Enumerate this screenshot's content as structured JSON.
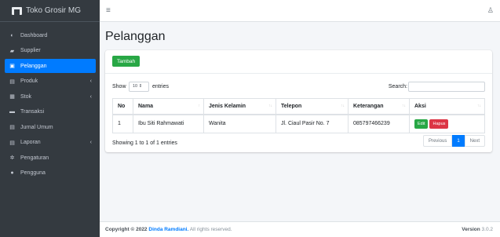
{
  "brand": {
    "name": "Toko Grosir MG"
  },
  "sidebar": {
    "items": [
      {
        "label": "Dashboard",
        "icon": "dashboard-icon",
        "glyph": "◐",
        "active": false,
        "has_children": false
      },
      {
        "label": "Supplier",
        "icon": "truck-icon",
        "glyph": "▰",
        "active": false,
        "has_children": false
      },
      {
        "label": "Pelanggan",
        "icon": "user-icon",
        "glyph": "▣",
        "active": true,
        "has_children": false
      },
      {
        "label": "Produk",
        "icon": "box-icon",
        "glyph": "▤",
        "active": false,
        "has_children": true
      },
      {
        "label": "Stok",
        "icon": "boxes-icon",
        "glyph": "▦",
        "active": false,
        "has_children": true
      },
      {
        "label": "Transaksi",
        "icon": "cash-icon",
        "glyph": "▬",
        "active": false,
        "has_children": false
      },
      {
        "label": "Jurnal Umum",
        "icon": "book-icon",
        "glyph": "▤",
        "active": false,
        "has_children": false
      },
      {
        "label": "Laporan",
        "icon": "file-icon",
        "glyph": "▤",
        "active": false,
        "has_children": true
      },
      {
        "label": "Pengaturan",
        "icon": "gear-icon",
        "glyph": "✲",
        "active": false,
        "has_children": false
      },
      {
        "label": "Pengguna",
        "icon": "users-icon",
        "glyph": "●",
        "active": false,
        "has_children": false
      }
    ]
  },
  "topbar": {
    "menu_icon": "hamburger-icon",
    "user_icon": "user-icon"
  },
  "page": {
    "title": "Pelanggan"
  },
  "card": {
    "add_button": "Tambah",
    "show_label": "Show",
    "page_length": "10",
    "entries_label": "entries",
    "search_label": "Search:",
    "search_value": ""
  },
  "table": {
    "headers": [
      "No",
      "Nama",
      "Jenis Kelamin",
      "Telepon",
      "Keterangan",
      "Aksi"
    ],
    "rows": [
      {
        "no": "1",
        "nama": "Ibu Siti Rahmawati",
        "jenis_kelamin": "Wanita",
        "telepon": "Jl. Ciaul Pasir No. 7",
        "keterangan": "085797466239",
        "edit_label": "Edit",
        "hapus_label": "Hapus"
      }
    ]
  },
  "info": {
    "showing": "Showing 1 to 1 of 1 entries"
  },
  "pagination": {
    "previous": "Previous",
    "current": "1",
    "next": "Next"
  },
  "footer": {
    "copyright_prefix": "Copyright © 2022",
    "author": "Dinda Ramdiani.",
    "rights": "All rights reserved.",
    "version_label": "Version",
    "version_value": "3.0.2"
  },
  "colors": {
    "sidebar": "#343a40",
    "active": "#007bff",
    "success": "#28a745",
    "danger": "#dc3545"
  }
}
